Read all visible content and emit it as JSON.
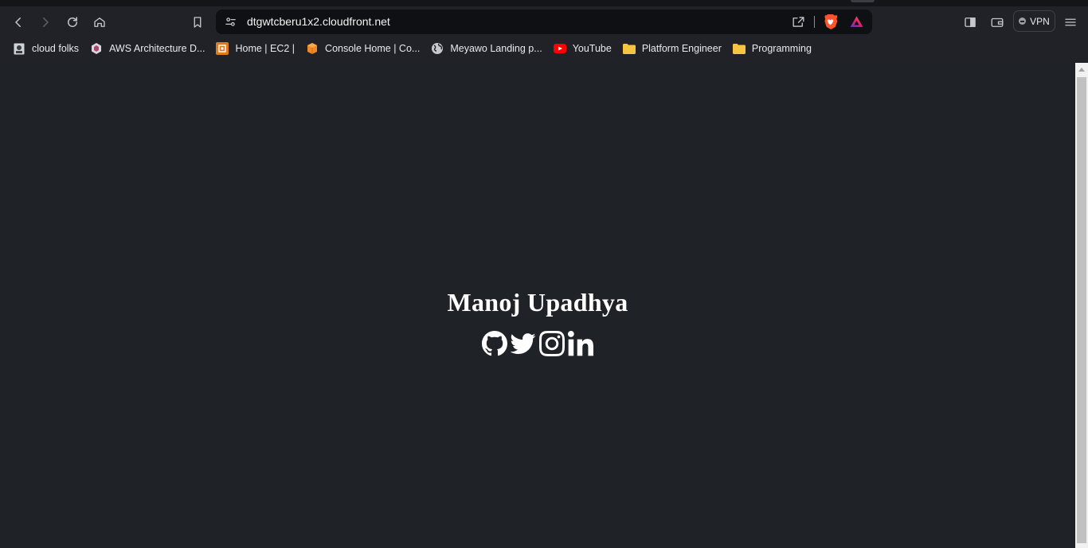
{
  "browser": {
    "url": "dtgwtcberu1x2.cloudfront.net",
    "vpn_label": "VPN",
    "colors": {
      "toolbar": "#202227",
      "urlbar": "#0f1013",
      "page_bg": "#1f2227",
      "brave_orange": "#fb542b"
    }
  },
  "bookmarks": [
    {
      "label": "cloud folks",
      "icon": "cloud-folks-favicon"
    },
    {
      "label": "AWS Architecture D...",
      "icon": "aws-architecture-favicon"
    },
    {
      "label": "Home | EC2 |",
      "icon": "ec2-favicon"
    },
    {
      "label": "Console Home | Co...",
      "icon": "aws-console-favicon"
    },
    {
      "label": "Meyawo Landing p...",
      "icon": "globe-favicon"
    },
    {
      "label": "YouTube",
      "icon": "youtube-favicon"
    },
    {
      "label": "Platform Engineer",
      "icon": "folder-icon"
    },
    {
      "label": "Programming",
      "icon": "folder-icon"
    }
  ],
  "page": {
    "name": "Manoj Upadhya",
    "socials": [
      {
        "network": "github",
        "icon": "github-icon"
      },
      {
        "network": "twitter",
        "icon": "twitter-icon"
      },
      {
        "network": "instagram",
        "icon": "instagram-icon"
      },
      {
        "network": "linkedin",
        "icon": "linkedin-icon"
      }
    ]
  }
}
